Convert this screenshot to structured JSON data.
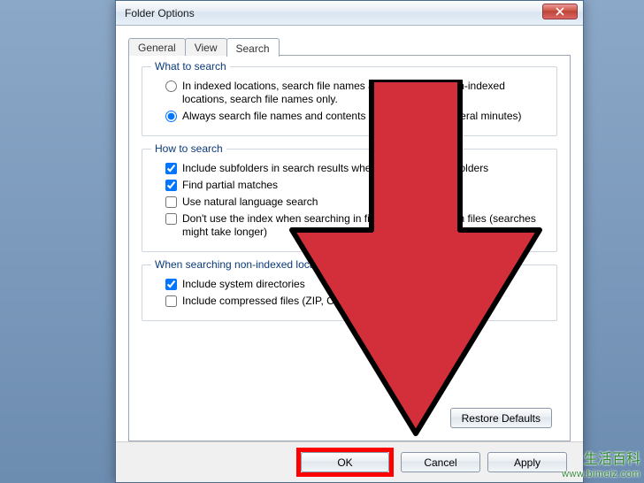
{
  "window": {
    "title": "Folder Options"
  },
  "tabs": {
    "general": "General",
    "view": "View",
    "search": "Search"
  },
  "group_what": {
    "title": "What to search",
    "opt_indexed": "In indexed locations, search file names and contents. In non-indexed locations, search file names only.",
    "opt_always": "Always search file names and contents (this might take several minutes)"
  },
  "group_how": {
    "title": "How to search",
    "opt_subfolders": "Include subfolders in search results when searching in file folders",
    "opt_partial": "Find partial matches",
    "opt_natural": "Use natural language search",
    "opt_noindex": "Don't use the index when searching in file folders for system files (searches might take longer)"
  },
  "group_nonidx": {
    "title": "When searching non-indexed locations",
    "opt_sysdirs": "Include system directories",
    "opt_compressed": "Include compressed files (ZIP, CAB...)"
  },
  "buttons": {
    "restore": "Restore Defaults",
    "ok": "OK",
    "cancel": "Cancel",
    "apply": "Apply"
  },
  "watermark": {
    "line1": "生活百科",
    "line2": "www.bimeiz.com"
  }
}
